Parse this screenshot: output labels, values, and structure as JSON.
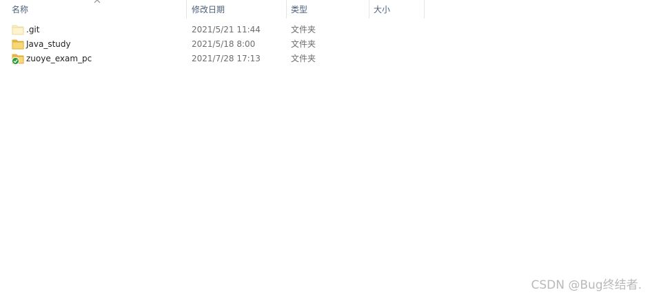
{
  "header": {
    "name": "名称",
    "date": "修改日期",
    "type": "类型",
    "size": "大小"
  },
  "files": [
    {
      "name": ".git",
      "date": "2021/5/21 11:44",
      "type": "文件夹",
      "icon": "folder-icon-faded"
    },
    {
      "name": "Java_study",
      "date": "2021/5/18 8:00",
      "type": "文件夹",
      "icon": "folder-icon"
    },
    {
      "name": "zuoye_exam_pc",
      "date": "2021/7/28 17:13",
      "type": "文件夹",
      "icon": "folder-synced-icon"
    }
  ],
  "watermark": "CSDN @Bug终结者.",
  "colors": {
    "header_text": "#4c607a",
    "folder_yellow": "#f8d775",
    "sync_green": "#2e9b3a"
  }
}
